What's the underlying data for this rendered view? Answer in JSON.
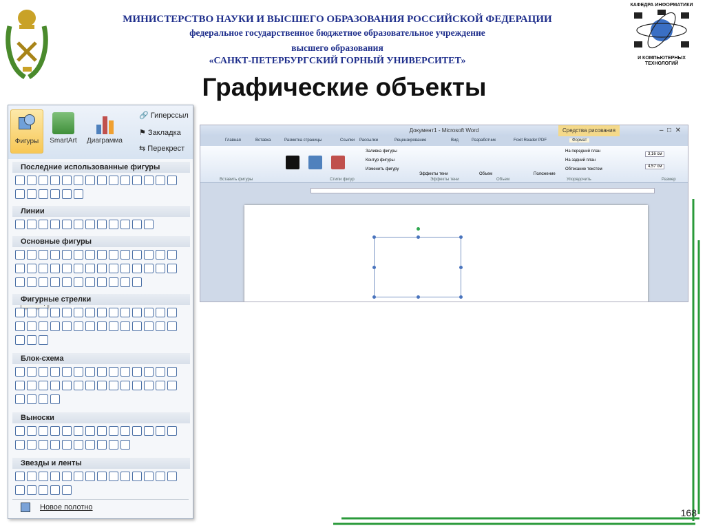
{
  "header": {
    "line1": "МИНИСТЕРСТВО НАУКИ И ВЫСШЕГО ОБРАЗОВАНИЯ РОССИЙСКОЙ ФЕДЕРАЦИИ",
    "line2": "федеральное государственное бюджетное образовательное учреждение",
    "line3": "высшего образования",
    "line4": "«САНКТ-ПЕТЕРБУРГСКИЙ ГОРНЫЙ УНИВЕРСИТЕТ»"
  },
  "title": "Графические объекты",
  "dept_logo": {
    "top": "КАФЕДРА ИНФОРМАТИКИ",
    "bottom": "И КОМПЬЮТЕРНЫХ ТЕХНОЛОГИЙ"
  },
  "shapes_panel": {
    "buttons": [
      "Фигуры",
      "SmartArt",
      "Диаграмма"
    ],
    "side_items": [
      "Гиперссыл",
      "Закладка",
      "Перекрест"
    ],
    "sections": [
      "Последние использованные фигуры",
      "Линии",
      "Основные фигуры",
      "Фигурные стрелки",
      "Блок-схема",
      "Выноски",
      "Звезды и ленты"
    ],
    "tooltip": "Месяц",
    "footer": "Новое полотно"
  },
  "word_window": {
    "title": "Документ1 - Microsoft Word",
    "context_tab": "Средства рисования",
    "tabs": [
      "Главная",
      "Вставка",
      "Разметка страницы",
      "Ссылки",
      "Рассылки",
      "Рецензирование",
      "Вид",
      "Разработчик",
      "Foxit Reader PDF",
      "Формат"
    ],
    "group_labels": [
      "Вставить фигуры",
      "Стили фигур",
      "Эффекты тени",
      "Объем",
      "Упорядочить",
      "Размер"
    ],
    "commands": [
      "Заливка фигуры",
      "Контур фигуры",
      "Изменить фигуру",
      "Эффекты тени",
      "Объем",
      "Положение",
      "На передний план",
      "На задний план",
      "Обтекание текстом"
    ],
    "size_height": "3,16 см",
    "size_width": "4,57 см",
    "colors": [
      "#111111",
      "#4f81bd",
      "#c0504d"
    ]
  },
  "slide_number": "168"
}
